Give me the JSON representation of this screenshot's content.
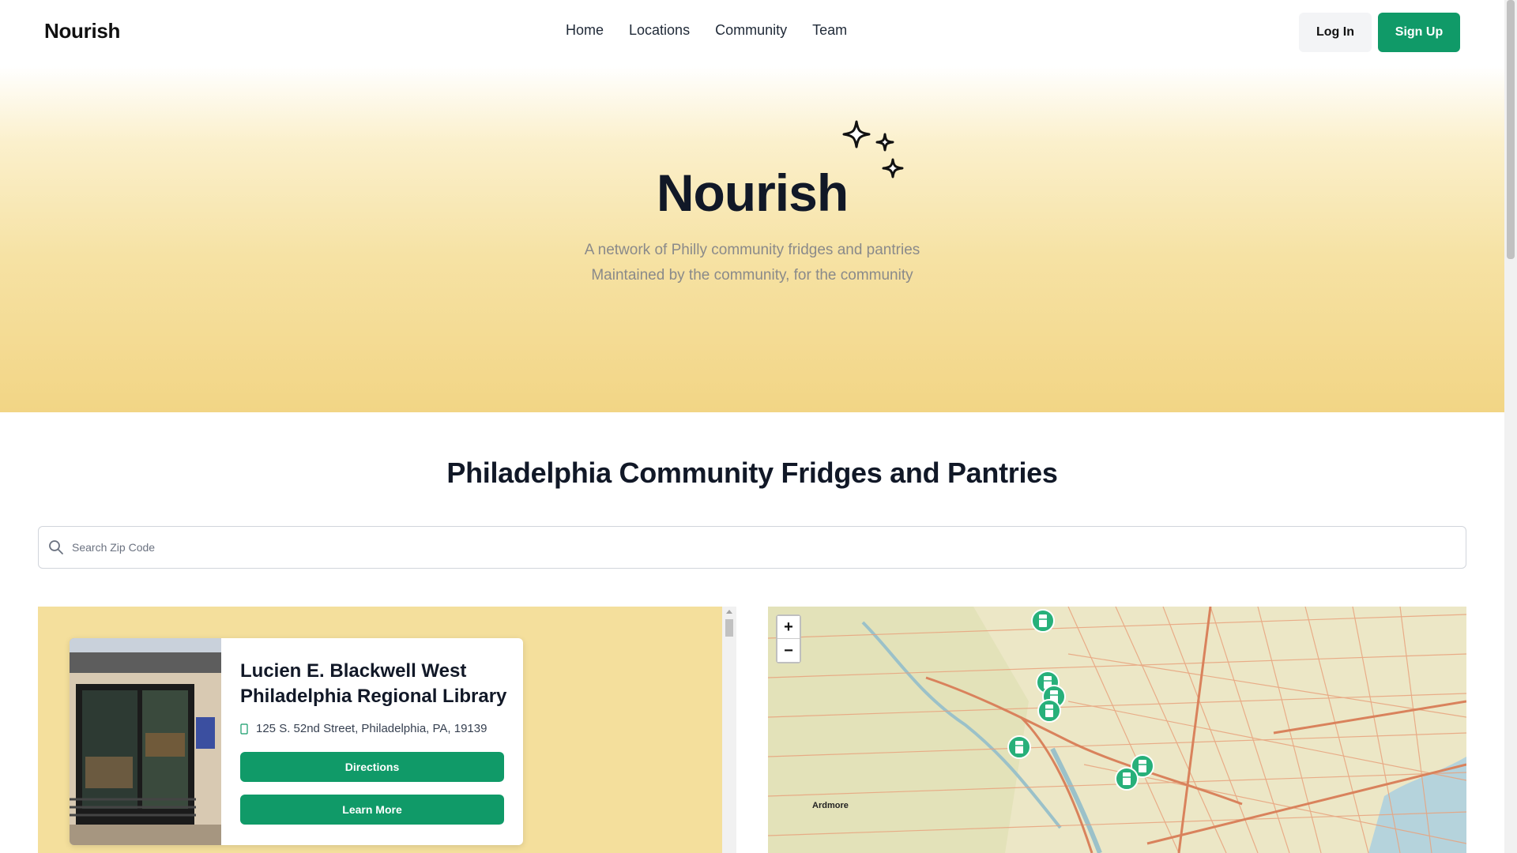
{
  "nav": {
    "brand": "Nourish",
    "links": [
      "Home",
      "Locations",
      "Community",
      "Team"
    ],
    "login_label": "Log In",
    "signup_label": "Sign Up"
  },
  "hero": {
    "title": "Nourish",
    "subtitle_line1": "A network of Philly community fridges and pantries",
    "subtitle_line2": "Maintained by the community, for the community",
    "decoration_icon": "sparkles-icon"
  },
  "section": {
    "title": "Philadelphia Community Fridges and Pantries"
  },
  "search": {
    "placeholder": "Search Zip Code",
    "value": "",
    "icon": "search-icon"
  },
  "locations": [
    {
      "name": "Lucien E. Blackwell West Philadelphia Regional Library",
      "address": "125 S. 52nd Street, Philadelphia, PA, 19139",
      "directions_label": "Directions",
      "learn_more_label": "Learn More",
      "image_icon": "fridge-photo"
    }
  ],
  "map": {
    "zoom_in_label": "+",
    "zoom_out_label": "−",
    "place_labels": [
      "Ardmore"
    ],
    "marker_icon": "fridge-marker-icon",
    "marker_count": 8
  },
  "colors": {
    "accent": "#109a68",
    "hero_gradient_end": "#f2d585",
    "list_panel_bg": "#f4df9c"
  }
}
